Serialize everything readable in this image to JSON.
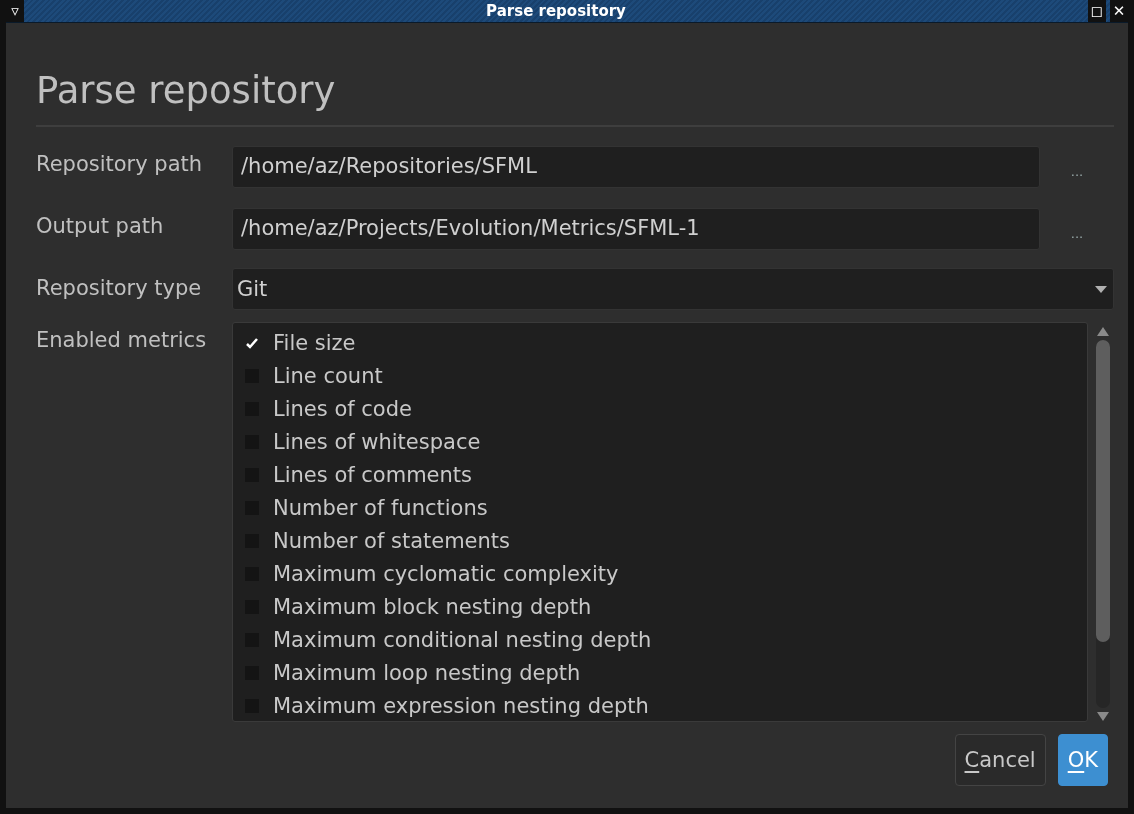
{
  "window": {
    "title": "Parse repository",
    "menu_glyph": "▿",
    "maximize_glyph": "◻",
    "close_glyph": "✕"
  },
  "heading": "Parse repository",
  "fields": [
    {
      "label": "Repository path",
      "value": "/home/az/Repositories/SFML",
      "browse": "..."
    },
    {
      "label": "Output path",
      "value": "/home/az/Projects/Evolution/Metrics/SFML-1",
      "browse": "..."
    }
  ],
  "repository_type": {
    "label": "Repository type",
    "value": "Git"
  },
  "metrics": {
    "label": "Enabled metrics",
    "items": [
      {
        "label": "File size",
        "checked": true
      },
      {
        "label": "Line count",
        "checked": false
      },
      {
        "label": "Lines of code",
        "checked": false
      },
      {
        "label": "Lines of whitespace",
        "checked": false
      },
      {
        "label": "Lines of comments",
        "checked": false
      },
      {
        "label": "Number of functions",
        "checked": false
      },
      {
        "label": "Number of statements",
        "checked": false
      },
      {
        "label": "Maximum cyclomatic complexity",
        "checked": false
      },
      {
        "label": "Maximum block nesting depth",
        "checked": false
      },
      {
        "label": "Maximum conditional nesting depth",
        "checked": false
      },
      {
        "label": "Maximum loop nesting depth",
        "checked": false
      },
      {
        "label": "Maximum expression nesting depth",
        "checked": false
      }
    ]
  },
  "buttons": [
    {
      "label": "Cancel",
      "default": false
    },
    {
      "label": "OK",
      "default": true
    }
  ]
}
